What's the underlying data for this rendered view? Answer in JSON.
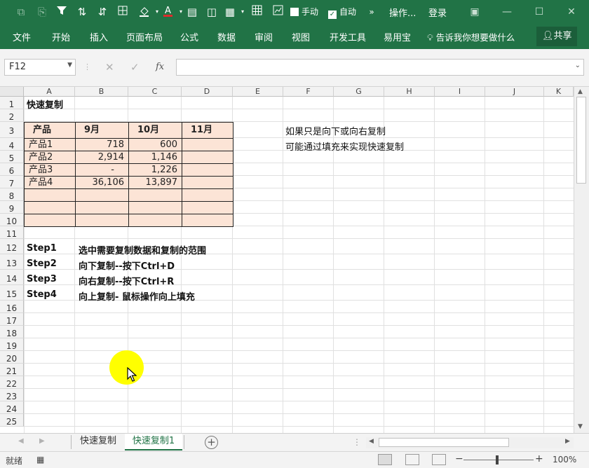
{
  "qat": {
    "manual_label": "手动",
    "auto_label": "自动",
    "ops_label": "操作...",
    "login_label": "登录"
  },
  "ribbon": {
    "tabs": [
      "文件",
      "开始",
      "插入",
      "页面布局",
      "公式",
      "数据",
      "审阅",
      "视图",
      "开发工具",
      "易用宝"
    ],
    "tell_me": "告诉我你想要做什么",
    "share": "共享"
  },
  "formula_bar": {
    "name_box": "F12",
    "fx_label": "fx",
    "formula": ""
  },
  "columns": [
    "A",
    "B",
    "C",
    "D",
    "E",
    "F",
    "G",
    "H",
    "I",
    "J",
    "K"
  ],
  "rows": [
    "1",
    "2",
    "3",
    "4",
    "5",
    "6",
    "7",
    "8",
    "9",
    "10",
    "11",
    "12",
    "13",
    "14",
    "15",
    "16",
    "17",
    "18",
    "19",
    "20",
    "21",
    "22",
    "23",
    "24",
    "25"
  ],
  "sheet": {
    "title": "快速复制",
    "table": {
      "headers": [
        "产品",
        "9月",
        "10月",
        "11月"
      ],
      "rows": [
        [
          "产品1",
          "718",
          "600",
          ""
        ],
        [
          "产品2",
          "2,914",
          "1,146",
          ""
        ],
        [
          "产品3",
          "-",
          "1,226",
          ""
        ],
        [
          "产品4",
          "36,106",
          "13,897",
          ""
        ],
        [
          "",
          "",
          "",
          ""
        ],
        [
          "",
          "",
          "",
          ""
        ],
        [
          "",
          "",
          "",
          ""
        ]
      ]
    },
    "notes": [
      "如果只是向下或向右复制",
      "可能通过填充来实现快速复制"
    ],
    "steps": [
      {
        "label": "Step1",
        "text": "选中需要复制数据和复制的范围"
      },
      {
        "label": "Step2",
        "text": "向下复制--按下Ctrl+D"
      },
      {
        "label": "Step3",
        "text": "向右复制--按下Ctrl+R"
      },
      {
        "label": "Step4",
        "text": "向上复制- 鼠标操作向上填充"
      }
    ]
  },
  "sheet_tabs": [
    "快速复制",
    "快速复制1"
  ],
  "active_sheet": 1,
  "status": {
    "ready": "就绪",
    "zoom": "100%"
  },
  "colors": {
    "brand": "#217346",
    "table_fill": "#fce4d6",
    "cursor_highlight": "#ffff00"
  }
}
